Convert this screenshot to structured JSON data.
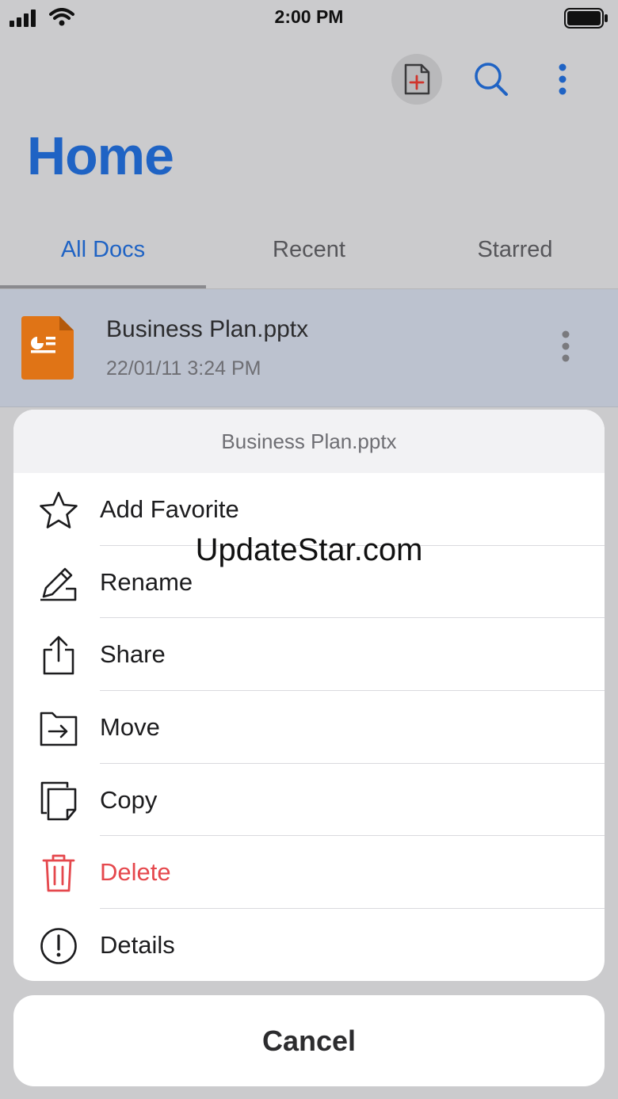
{
  "status_bar": {
    "time": "2:00 PM"
  },
  "header": {
    "title": "Home"
  },
  "tabs": [
    {
      "label": "All Docs"
    },
    {
      "label": "Recent"
    },
    {
      "label": "Starred"
    }
  ],
  "document": {
    "name": "Business Plan.pptx",
    "date": "22/01/11 3:24 PM"
  },
  "action_sheet": {
    "title": "Business Plan.pptx",
    "items": [
      {
        "label": "Add Favorite",
        "icon": "star-icon"
      },
      {
        "label": "Rename",
        "icon": "pencil-icon"
      },
      {
        "label": "Share",
        "icon": "share-icon"
      },
      {
        "label": "Move",
        "icon": "move-icon"
      },
      {
        "label": "Copy",
        "icon": "copy-icon"
      },
      {
        "label": "Delete",
        "icon": "trash-icon"
      },
      {
        "label": "Details",
        "icon": "info-icon"
      }
    ],
    "cancel_label": "Cancel"
  },
  "watermark": "UpdateStar.com",
  "colors": {
    "accent": "#1f63c4",
    "danger": "#e5484d",
    "file_icon": "#e07416"
  }
}
